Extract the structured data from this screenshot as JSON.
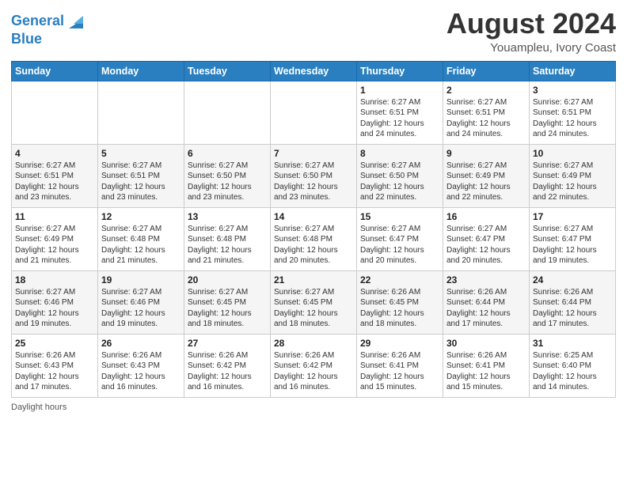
{
  "header": {
    "logo_line1": "General",
    "logo_line2": "Blue",
    "title": "August 2024",
    "subtitle": "Youampleu, Ivory Coast"
  },
  "days_of_week": [
    "Sunday",
    "Monday",
    "Tuesday",
    "Wednesday",
    "Thursday",
    "Friday",
    "Saturday"
  ],
  "weeks": [
    [
      {
        "day": "",
        "info": ""
      },
      {
        "day": "",
        "info": ""
      },
      {
        "day": "",
        "info": ""
      },
      {
        "day": "",
        "info": ""
      },
      {
        "day": "1",
        "info": "Sunrise: 6:27 AM\nSunset: 6:51 PM\nDaylight: 12 hours\nand 24 minutes."
      },
      {
        "day": "2",
        "info": "Sunrise: 6:27 AM\nSunset: 6:51 PM\nDaylight: 12 hours\nand 24 minutes."
      },
      {
        "day": "3",
        "info": "Sunrise: 6:27 AM\nSunset: 6:51 PM\nDaylight: 12 hours\nand 24 minutes."
      }
    ],
    [
      {
        "day": "4",
        "info": "Sunrise: 6:27 AM\nSunset: 6:51 PM\nDaylight: 12 hours\nand 23 minutes."
      },
      {
        "day": "5",
        "info": "Sunrise: 6:27 AM\nSunset: 6:51 PM\nDaylight: 12 hours\nand 23 minutes."
      },
      {
        "day": "6",
        "info": "Sunrise: 6:27 AM\nSunset: 6:50 PM\nDaylight: 12 hours\nand 23 minutes."
      },
      {
        "day": "7",
        "info": "Sunrise: 6:27 AM\nSunset: 6:50 PM\nDaylight: 12 hours\nand 23 minutes."
      },
      {
        "day": "8",
        "info": "Sunrise: 6:27 AM\nSunset: 6:50 PM\nDaylight: 12 hours\nand 22 minutes."
      },
      {
        "day": "9",
        "info": "Sunrise: 6:27 AM\nSunset: 6:49 PM\nDaylight: 12 hours\nand 22 minutes."
      },
      {
        "day": "10",
        "info": "Sunrise: 6:27 AM\nSunset: 6:49 PM\nDaylight: 12 hours\nand 22 minutes."
      }
    ],
    [
      {
        "day": "11",
        "info": "Sunrise: 6:27 AM\nSunset: 6:49 PM\nDaylight: 12 hours\nand 21 minutes."
      },
      {
        "day": "12",
        "info": "Sunrise: 6:27 AM\nSunset: 6:48 PM\nDaylight: 12 hours\nand 21 minutes."
      },
      {
        "day": "13",
        "info": "Sunrise: 6:27 AM\nSunset: 6:48 PM\nDaylight: 12 hours\nand 21 minutes."
      },
      {
        "day": "14",
        "info": "Sunrise: 6:27 AM\nSunset: 6:48 PM\nDaylight: 12 hours\nand 20 minutes."
      },
      {
        "day": "15",
        "info": "Sunrise: 6:27 AM\nSunset: 6:47 PM\nDaylight: 12 hours\nand 20 minutes."
      },
      {
        "day": "16",
        "info": "Sunrise: 6:27 AM\nSunset: 6:47 PM\nDaylight: 12 hours\nand 20 minutes."
      },
      {
        "day": "17",
        "info": "Sunrise: 6:27 AM\nSunset: 6:47 PM\nDaylight: 12 hours\nand 19 minutes."
      }
    ],
    [
      {
        "day": "18",
        "info": "Sunrise: 6:27 AM\nSunset: 6:46 PM\nDaylight: 12 hours\nand 19 minutes."
      },
      {
        "day": "19",
        "info": "Sunrise: 6:27 AM\nSunset: 6:46 PM\nDaylight: 12 hours\nand 19 minutes."
      },
      {
        "day": "20",
        "info": "Sunrise: 6:27 AM\nSunset: 6:45 PM\nDaylight: 12 hours\nand 18 minutes."
      },
      {
        "day": "21",
        "info": "Sunrise: 6:27 AM\nSunset: 6:45 PM\nDaylight: 12 hours\nand 18 minutes."
      },
      {
        "day": "22",
        "info": "Sunrise: 6:26 AM\nSunset: 6:45 PM\nDaylight: 12 hours\nand 18 minutes."
      },
      {
        "day": "23",
        "info": "Sunrise: 6:26 AM\nSunset: 6:44 PM\nDaylight: 12 hours\nand 17 minutes."
      },
      {
        "day": "24",
        "info": "Sunrise: 6:26 AM\nSunset: 6:44 PM\nDaylight: 12 hours\nand 17 minutes."
      }
    ],
    [
      {
        "day": "25",
        "info": "Sunrise: 6:26 AM\nSunset: 6:43 PM\nDaylight: 12 hours\nand 17 minutes."
      },
      {
        "day": "26",
        "info": "Sunrise: 6:26 AM\nSunset: 6:43 PM\nDaylight: 12 hours\nand 16 minutes."
      },
      {
        "day": "27",
        "info": "Sunrise: 6:26 AM\nSunset: 6:42 PM\nDaylight: 12 hours\nand 16 minutes."
      },
      {
        "day": "28",
        "info": "Sunrise: 6:26 AM\nSunset: 6:42 PM\nDaylight: 12 hours\nand 16 minutes."
      },
      {
        "day": "29",
        "info": "Sunrise: 6:26 AM\nSunset: 6:41 PM\nDaylight: 12 hours\nand 15 minutes."
      },
      {
        "day": "30",
        "info": "Sunrise: 6:26 AM\nSunset: 6:41 PM\nDaylight: 12 hours\nand 15 minutes."
      },
      {
        "day": "31",
        "info": "Sunrise: 6:25 AM\nSunset: 6:40 PM\nDaylight: 12 hours\nand 14 minutes."
      }
    ]
  ],
  "footer": {
    "daylight_label": "Daylight hours"
  }
}
